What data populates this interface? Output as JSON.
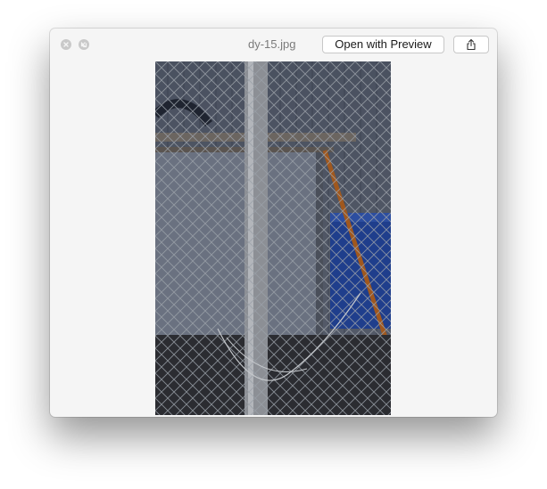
{
  "window": {
    "title": "dy-15.jpg"
  },
  "toolbar": {
    "open_with_label": "Open with Preview",
    "share_icon": "share-icon"
  },
  "controls": {
    "close_icon": "close-icon",
    "fullscreen_icon": "fullscreen-icon"
  },
  "preview": {
    "subject": "photo-chain-link-fence"
  }
}
